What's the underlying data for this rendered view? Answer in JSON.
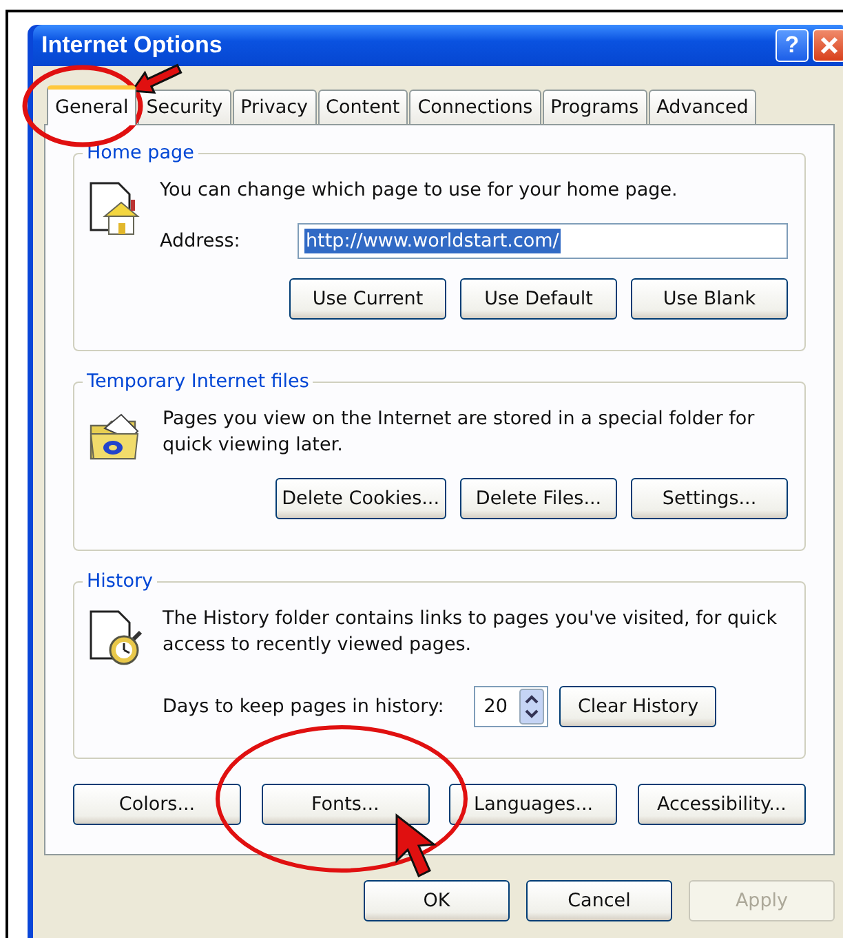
{
  "window": {
    "title": "Internet Options",
    "help": "?"
  },
  "tabs": [
    {
      "label": "General",
      "selected": true
    },
    {
      "label": "Security",
      "selected": false
    },
    {
      "label": "Privacy",
      "selected": false
    },
    {
      "label": "Content",
      "selected": false
    },
    {
      "label": "Connections",
      "selected": false
    },
    {
      "label": "Programs",
      "selected": false
    },
    {
      "label": "Advanced",
      "selected": false
    }
  ],
  "home_page": {
    "legend": "Home page",
    "description": "You can change which page to use for your home page.",
    "address_label": "Address:",
    "address_value": "http://www.worldstart.com/",
    "address_selected": true,
    "buttons": [
      "Use Current",
      "Use Default",
      "Use Blank"
    ]
  },
  "temporary_files": {
    "legend": "Temporary Internet files",
    "description": "Pages you view on the Internet are stored in a special folder for quick viewing later.",
    "buttons": [
      "Delete Cookies...",
      "Delete Files...",
      "Settings..."
    ]
  },
  "history": {
    "legend": "History",
    "description": "The History folder contains links to pages you've visited, for quick access to recently viewed pages.",
    "days_label": "Days to keep pages in history:",
    "days_value": "20",
    "buttons": [
      "Clear History"
    ]
  },
  "appearance_buttons": [
    "Colors...",
    "Fonts...",
    "Languages...",
    "Accessibility..."
  ],
  "dialog_buttons": [
    {
      "label": "OK",
      "disabled": false
    },
    {
      "label": "Cancel",
      "disabled": false
    },
    {
      "label": "Apply",
      "disabled": true
    }
  ]
}
